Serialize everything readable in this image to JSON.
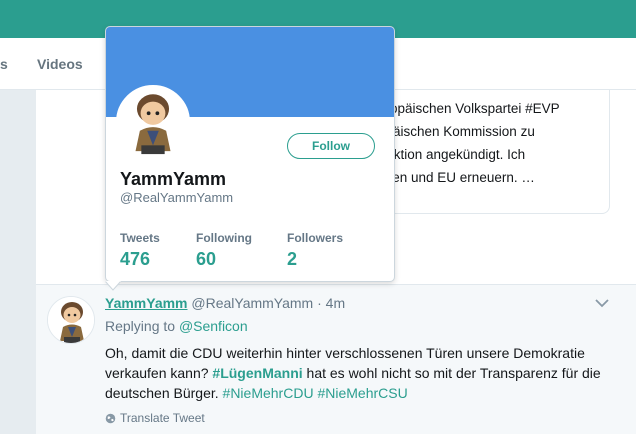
{
  "nav": {
    "partial_tab": "s",
    "videos_label": "Videos"
  },
  "quoted_tweet": {
    "lines": [
      "uropäischen Volkspartei #EVP",
      "opäischen Kommission zu",
      "fraktion angekündigt. Ich",
      "chen und EU erneuern. …"
    ]
  },
  "profile_card": {
    "name": "YammYamm",
    "handle": "@RealYammYamm",
    "follow_label": "Follow",
    "stats": [
      {
        "label": "Tweets",
        "value": "476"
      },
      {
        "label": "Following",
        "value": "60"
      },
      {
        "label": "Followers",
        "value": "2"
      }
    ],
    "banner_color": "#4a90e2"
  },
  "tweet": {
    "name": "YammYamm",
    "handle": "@RealYammYamm",
    "dot": "·",
    "time": "4m",
    "replying_prefix": "Replying to",
    "replying_handle": "@Senficon",
    "text_1": "Oh, damit die CDU weiterhin hinter verschlossenen Türen unsere Demokratie verkaufen kann?",
    "hashtag_1": "#LügenManni",
    "text_2": "hat es wohl nicht so mit der Transparenz für die deutschen Bürger.",
    "hashtag_2": "#NieMehrCDU",
    "hashtag_3": "#NieMehrCSU",
    "translate_label": "Translate Tweet"
  },
  "colors": {
    "accent": "#2b9e8f",
    "topbar": "#2b9e8f",
    "muted": "#657786"
  },
  "icons": {
    "avatar": "doctor-who-figure-avatar",
    "chevron": "chevron-down-icon",
    "translate": "globe-icon"
  }
}
